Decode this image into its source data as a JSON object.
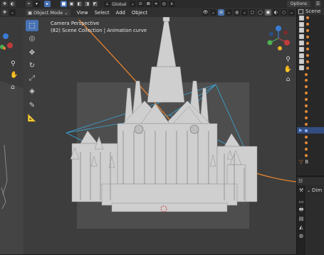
{
  "topbar": {
    "orientation_label": "Global",
    "options_label": "Options"
  },
  "viewport_header": {
    "mode_label": "Object Mode",
    "menu": [
      "View",
      "Select",
      "Add",
      "Object"
    ]
  },
  "viewport": {
    "camera_title": "Camera Perspective",
    "scene_info": "(82) Scene Collection | Animation curve"
  },
  "outliner": {
    "title": "Scene",
    "bottom_item": "B"
  },
  "properties": {
    "section_label": "Dim"
  },
  "colors": {
    "accent": "#4772b3",
    "animation_curve": "#e8832e",
    "frustum_lines": "#3aa8d8"
  },
  "icons": {
    "tools": [
      "select-box-icon",
      "cursor-icon",
      "move-icon",
      "rotate-icon",
      "scale-icon",
      "transform-icon",
      "annotate-icon",
      "measure-icon"
    ],
    "navigation": [
      "zoom-icon",
      "pan-hand-icon",
      "camera-view-icon"
    ]
  }
}
